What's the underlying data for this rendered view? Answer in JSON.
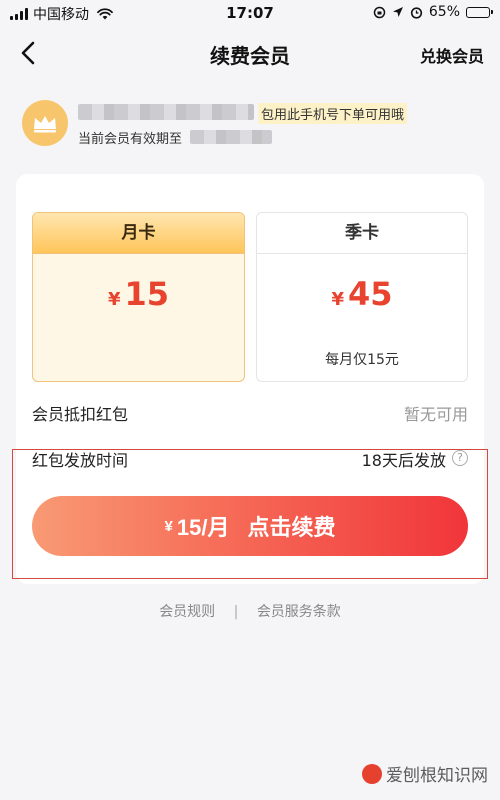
{
  "status_bar": {
    "carrier": "中国移动",
    "time": "17:07",
    "battery": "65%",
    "battery_level": 0.65
  },
  "nav": {
    "title": "续费会员",
    "redeem_label": "兑换会员"
  },
  "member": {
    "notice": "包用此手机号下单可用哦",
    "expiry_prefix": "当前会员有效期至"
  },
  "plans": [
    {
      "name": "月卡",
      "currency": "¥",
      "price": "15",
      "selected": true
    },
    {
      "name": "季卡",
      "currency": "¥",
      "price": "45",
      "subtitle": "每月仅15元",
      "selected": false
    }
  ],
  "red_packet": {
    "label": "会员抵扣红包",
    "value": "暂无可用"
  },
  "release_time": {
    "label": "红包发放时间",
    "value": "18天后发放",
    "help": "?"
  },
  "renew_button": {
    "currency": "¥",
    "price_text": "15/月",
    "action": "点击续费"
  },
  "footer": {
    "rules": "会员规则",
    "separator": "|",
    "terms": "会员服务条款"
  },
  "watermark": {
    "text": "爱刨根知识网"
  },
  "colors": {
    "accent_red": "#e8432f",
    "gold": "#ffc55a",
    "highlight": "#d4483e"
  }
}
